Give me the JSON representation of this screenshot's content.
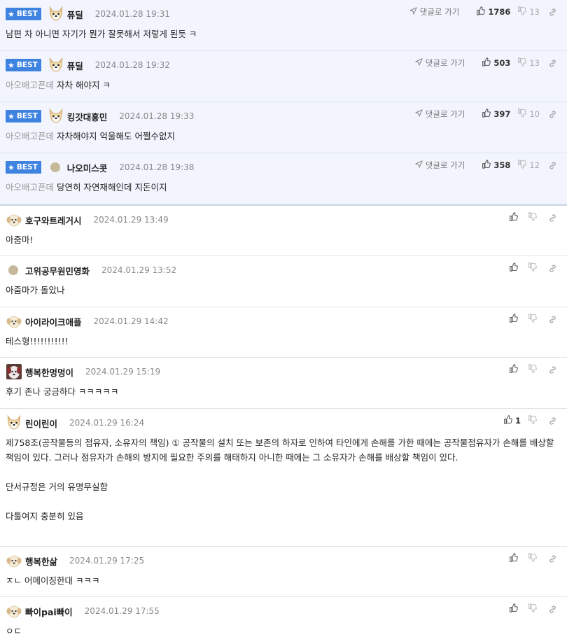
{
  "ui": {
    "best_badge": "BEST",
    "goto_label": "댓글로 가기"
  },
  "best_comments": [
    {
      "nick": "퓨딜",
      "date": "2024.01.28 19:31",
      "quote": "",
      "text": "남편 차 아니면 자기가 뭔가 잘못해서 저렇게 된듯 ㅋ",
      "up": "1786",
      "down": "13",
      "avatar": "dog-face-icon"
    },
    {
      "nick": "퓨딜",
      "date": "2024.01.28 19:32",
      "quote": "아오배고픈데",
      "text": "자차 해야지 ㅋ",
      "up": "503",
      "down": "13",
      "avatar": "dog-face-icon"
    },
    {
      "nick": "킹갓대흥민",
      "date": "2024.01.28 19:33",
      "quote": "아오배고픈데",
      "text": "자차해야지 억울해도 어쩔수없지",
      "up": "397",
      "down": "10",
      "avatar": "dog-face-icon"
    },
    {
      "nick": "나오미스콧",
      "date": "2024.01.28 19:38",
      "quote": "아오배고픈데",
      "text": "당연히 자연재해인데 지돈이지",
      "up": "358",
      "down": "12",
      "avatar": "level-dot-icon"
    }
  ],
  "comments": [
    {
      "nick": "호구와트레거시",
      "date": "2024.01.29 13:49",
      "paragraphs": [
        "아줌마!"
      ],
      "up": "",
      "avatar": "puppy-icon"
    },
    {
      "nick": "고위공무원민영화",
      "date": "2024.01.29 13:52",
      "paragraphs": [
        "아줌마가 돌았나"
      ],
      "up": "",
      "avatar": "level-dot-icon"
    },
    {
      "nick": "아이라이크애플",
      "date": "2024.01.29 14:42",
      "paragraphs": [
        "테스형!!!!!!!!!!!"
      ],
      "up": "",
      "avatar": "puppy-icon"
    },
    {
      "nick": "행복한멍멍이",
      "date": "2024.01.29 15:19",
      "paragraphs": [
        "후기 존나 궁금하다 ㅋㅋㅋㅋㅋ"
      ],
      "up": "",
      "avatar": "dog-photo-icon"
    },
    {
      "nick": "린이린이",
      "date": "2024.01.29 16:24",
      "paragraphs": [
        "제758조(공작물등의 점유자, 소유자의 책임) ① 공작물의 설치 또는 보존의 하자로 인하여 타인에게 손해를 가한 때에는 공작물점유자가 손해를 배상할 책임이 있다. 그러나 점유자가 손해의 방지에 필요한 주의를 해태하지 아니한 때에는 그 소유자가 손해를 배상할 책임이 있다.",
        "단서규정은 거의 유명무실함",
        "다툴여지 충분히 있음"
      ],
      "up": "1",
      "avatar": "dog-face-icon"
    },
    {
      "nick": "행복한삶",
      "date": "2024.01.29 17:25",
      "paragraphs": [
        "ㅈㄴ 어메이징한대 ㅋㅋㅋ"
      ],
      "up": "",
      "avatar": "puppy-icon"
    },
    {
      "nick": "빠이pai빠이",
      "date": "2024.01.29 17:55",
      "paragraphs": [
        "ㅇㄷ"
      ],
      "up": "",
      "avatar": "puppy-icon"
    }
  ]
}
